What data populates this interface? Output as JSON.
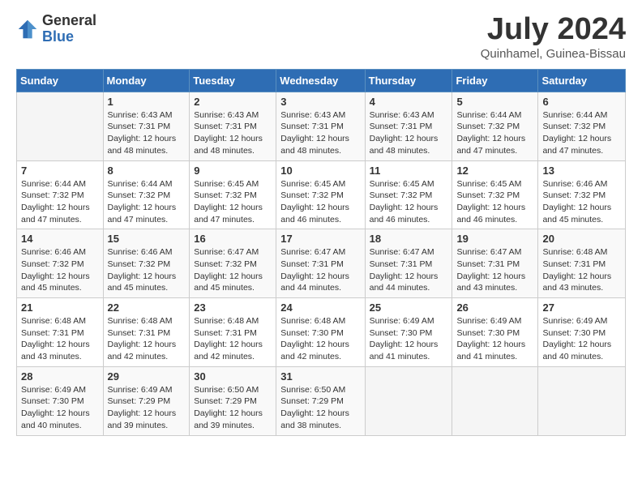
{
  "logo": {
    "general": "General",
    "blue": "Blue"
  },
  "title": "July 2024",
  "subtitle": "Quinhamel, Guinea-Bissau",
  "weekdays": [
    "Sunday",
    "Monday",
    "Tuesday",
    "Wednesday",
    "Thursday",
    "Friday",
    "Saturday"
  ],
  "weeks": [
    [
      {
        "day": "",
        "detail": ""
      },
      {
        "day": "1",
        "detail": "Sunrise: 6:43 AM\nSunset: 7:31 PM\nDaylight: 12 hours\nand 48 minutes."
      },
      {
        "day": "2",
        "detail": "Sunrise: 6:43 AM\nSunset: 7:31 PM\nDaylight: 12 hours\nand 48 minutes."
      },
      {
        "day": "3",
        "detail": "Sunrise: 6:43 AM\nSunset: 7:31 PM\nDaylight: 12 hours\nand 48 minutes."
      },
      {
        "day": "4",
        "detail": "Sunrise: 6:43 AM\nSunset: 7:31 PM\nDaylight: 12 hours\nand 48 minutes."
      },
      {
        "day": "5",
        "detail": "Sunrise: 6:44 AM\nSunset: 7:32 PM\nDaylight: 12 hours\nand 47 minutes."
      },
      {
        "day": "6",
        "detail": "Sunrise: 6:44 AM\nSunset: 7:32 PM\nDaylight: 12 hours\nand 47 minutes."
      }
    ],
    [
      {
        "day": "7",
        "detail": "Sunrise: 6:44 AM\nSunset: 7:32 PM\nDaylight: 12 hours\nand 47 minutes."
      },
      {
        "day": "8",
        "detail": "Sunrise: 6:44 AM\nSunset: 7:32 PM\nDaylight: 12 hours\nand 47 minutes."
      },
      {
        "day": "9",
        "detail": "Sunrise: 6:45 AM\nSunset: 7:32 PM\nDaylight: 12 hours\nand 47 minutes."
      },
      {
        "day": "10",
        "detail": "Sunrise: 6:45 AM\nSunset: 7:32 PM\nDaylight: 12 hours\nand 46 minutes."
      },
      {
        "day": "11",
        "detail": "Sunrise: 6:45 AM\nSunset: 7:32 PM\nDaylight: 12 hours\nand 46 minutes."
      },
      {
        "day": "12",
        "detail": "Sunrise: 6:45 AM\nSunset: 7:32 PM\nDaylight: 12 hours\nand 46 minutes."
      },
      {
        "day": "13",
        "detail": "Sunrise: 6:46 AM\nSunset: 7:32 PM\nDaylight: 12 hours\nand 45 minutes."
      }
    ],
    [
      {
        "day": "14",
        "detail": "Sunrise: 6:46 AM\nSunset: 7:32 PM\nDaylight: 12 hours\nand 45 minutes."
      },
      {
        "day": "15",
        "detail": "Sunrise: 6:46 AM\nSunset: 7:32 PM\nDaylight: 12 hours\nand 45 minutes."
      },
      {
        "day": "16",
        "detail": "Sunrise: 6:47 AM\nSunset: 7:32 PM\nDaylight: 12 hours\nand 45 minutes."
      },
      {
        "day": "17",
        "detail": "Sunrise: 6:47 AM\nSunset: 7:31 PM\nDaylight: 12 hours\nand 44 minutes."
      },
      {
        "day": "18",
        "detail": "Sunrise: 6:47 AM\nSunset: 7:31 PM\nDaylight: 12 hours\nand 44 minutes."
      },
      {
        "day": "19",
        "detail": "Sunrise: 6:47 AM\nSunset: 7:31 PM\nDaylight: 12 hours\nand 43 minutes."
      },
      {
        "day": "20",
        "detail": "Sunrise: 6:48 AM\nSunset: 7:31 PM\nDaylight: 12 hours\nand 43 minutes."
      }
    ],
    [
      {
        "day": "21",
        "detail": "Sunrise: 6:48 AM\nSunset: 7:31 PM\nDaylight: 12 hours\nand 43 minutes."
      },
      {
        "day": "22",
        "detail": "Sunrise: 6:48 AM\nSunset: 7:31 PM\nDaylight: 12 hours\nand 42 minutes."
      },
      {
        "day": "23",
        "detail": "Sunrise: 6:48 AM\nSunset: 7:31 PM\nDaylight: 12 hours\nand 42 minutes."
      },
      {
        "day": "24",
        "detail": "Sunrise: 6:48 AM\nSunset: 7:30 PM\nDaylight: 12 hours\nand 42 minutes."
      },
      {
        "day": "25",
        "detail": "Sunrise: 6:49 AM\nSunset: 7:30 PM\nDaylight: 12 hours\nand 41 minutes."
      },
      {
        "day": "26",
        "detail": "Sunrise: 6:49 AM\nSunset: 7:30 PM\nDaylight: 12 hours\nand 41 minutes."
      },
      {
        "day": "27",
        "detail": "Sunrise: 6:49 AM\nSunset: 7:30 PM\nDaylight: 12 hours\nand 40 minutes."
      }
    ],
    [
      {
        "day": "28",
        "detail": "Sunrise: 6:49 AM\nSunset: 7:30 PM\nDaylight: 12 hours\nand 40 minutes."
      },
      {
        "day": "29",
        "detail": "Sunrise: 6:49 AM\nSunset: 7:29 PM\nDaylight: 12 hours\nand 39 minutes."
      },
      {
        "day": "30",
        "detail": "Sunrise: 6:50 AM\nSunset: 7:29 PM\nDaylight: 12 hours\nand 39 minutes."
      },
      {
        "day": "31",
        "detail": "Sunrise: 6:50 AM\nSunset: 7:29 PM\nDaylight: 12 hours\nand 38 minutes."
      },
      {
        "day": "",
        "detail": ""
      },
      {
        "day": "",
        "detail": ""
      },
      {
        "day": "",
        "detail": ""
      }
    ]
  ]
}
